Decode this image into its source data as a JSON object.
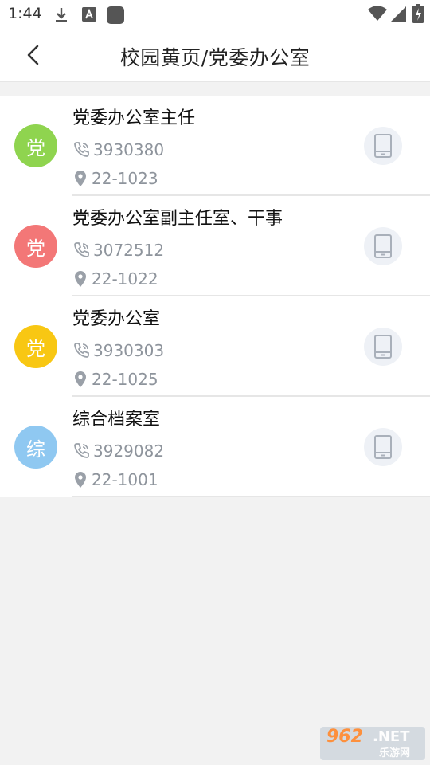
{
  "status_bar": {
    "time": "1:44",
    "icons": [
      "download-icon",
      "a-icon",
      "app-square-icon",
      "wifi-icon",
      "signal-icon",
      "battery-charging-icon"
    ]
  },
  "header": {
    "title": "校园黄页/党委办公室",
    "back_icon": "chevron-left-icon"
  },
  "contacts": [
    {
      "avatar": "党",
      "avatar_color": "#8fd44f",
      "name": "党委办公室主任",
      "phone": "3930380",
      "location": "22-1023"
    },
    {
      "avatar": "党",
      "avatar_color": "#f37777",
      "name": "党委办公室副主任室、干事",
      "phone": "3072512",
      "location": "22-1022"
    },
    {
      "avatar": "党",
      "avatar_color": "#f8c713",
      "name": "党委办公室",
      "phone": "3930303",
      "location": "22-1025"
    },
    {
      "avatar": "综",
      "avatar_color": "#8fc8f1",
      "name": "综合档案室",
      "phone": "3929082",
      "location": "22-1001"
    }
  ],
  "watermark": {
    "top": "962",
    "net": ".NET",
    "bottom": "乐游网"
  }
}
